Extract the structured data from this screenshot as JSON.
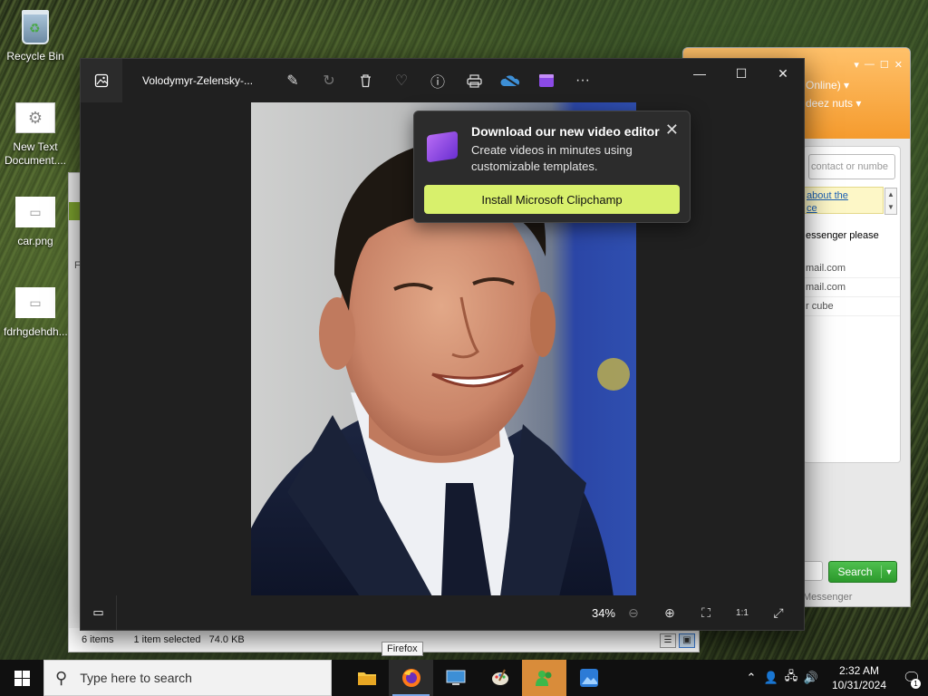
{
  "desktop": {
    "icons": [
      {
        "label": "Recycle Bin"
      },
      {
        "label": "New Text Document...."
      },
      {
        "label": "car.png"
      },
      {
        "label": "fdrhgdehdh..."
      }
    ]
  },
  "explorer": {
    "status_items": "6 items",
    "status_selected": "1 item selected",
    "status_size": "74.0 KB",
    "side_letter": "F"
  },
  "messenger": {
    "status_line": "Online)",
    "name_line": "deez nuts",
    "search_placeholder": "contact or numbe",
    "note_line1": "about the",
    "note_line2": "ce",
    "message_line": "essenger please",
    "contacts": [
      "mail.com",
      "mail.com",
      "r cube"
    ],
    "search_button": "Search",
    "footer": "Messenger"
  },
  "photos": {
    "file_name": "Volodymyr-Zelensky-...",
    "zoom_level": "34%",
    "toolbar": [
      {
        "name": "edit-icon",
        "glyph": "✎"
      },
      {
        "name": "rotate-icon",
        "glyph": "↻"
      },
      {
        "name": "delete-icon",
        "glyph": "🗑"
      },
      {
        "name": "favorite-icon",
        "glyph": "♡"
      },
      {
        "name": "info-icon",
        "glyph": "ⓘ"
      },
      {
        "name": "print-icon",
        "glyph": "⎙"
      },
      {
        "name": "onedrive-icon",
        "glyph": "☁"
      },
      {
        "name": "clipchamp-icon",
        "glyph": "▰"
      },
      {
        "name": "more-icon",
        "glyph": "···"
      }
    ],
    "window_controls": {
      "minimize": "—",
      "maximize": "☐",
      "close": "✕"
    }
  },
  "popup": {
    "title": "Download our new video editor",
    "body": "Create videos in minutes using customizable templates.",
    "button": "Install Microsoft Clipchamp",
    "close": "✕"
  },
  "tooltip": "Firefox",
  "taskbar": {
    "search_placeholder": "Type here to search",
    "time": "2:32 AM",
    "date": "10/31/2024",
    "notification_count": "1"
  },
  "colors": {
    "accent_install": "#d8f06c",
    "messenger_orange": "#f59b2e",
    "search_green": "#2c9a2c"
  }
}
